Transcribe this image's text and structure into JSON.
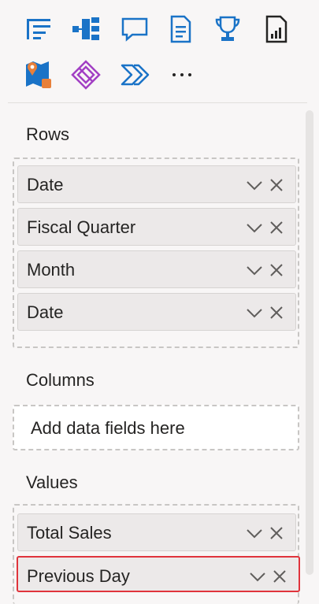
{
  "gallery": {
    "icons": [
      "matrix-icon",
      "decomposition-tree-icon",
      "qa-chat-icon",
      "smart-narrative-icon",
      "key-influencer-trophy-icon",
      "paginated-report-icon",
      "azure-map-icon",
      "power-apps-icon",
      "power-automate-icon",
      "more-options-icon"
    ],
    "more_label": "···"
  },
  "sections": {
    "rows": {
      "title": "Rows",
      "fields": [
        "Date",
        "Fiscal Quarter",
        "Month",
        "Date"
      ]
    },
    "columns": {
      "title": "Columns",
      "placeholder": "Add data fields here"
    },
    "values": {
      "title": "Values",
      "fields": [
        "Total Sales",
        "Previous Day"
      ],
      "selected_index": 1
    }
  },
  "colors": {
    "accent": "#1a73c7",
    "selected_border": "#e0343c",
    "purple": "#a23fc4",
    "orange": "#e8803a"
  }
}
